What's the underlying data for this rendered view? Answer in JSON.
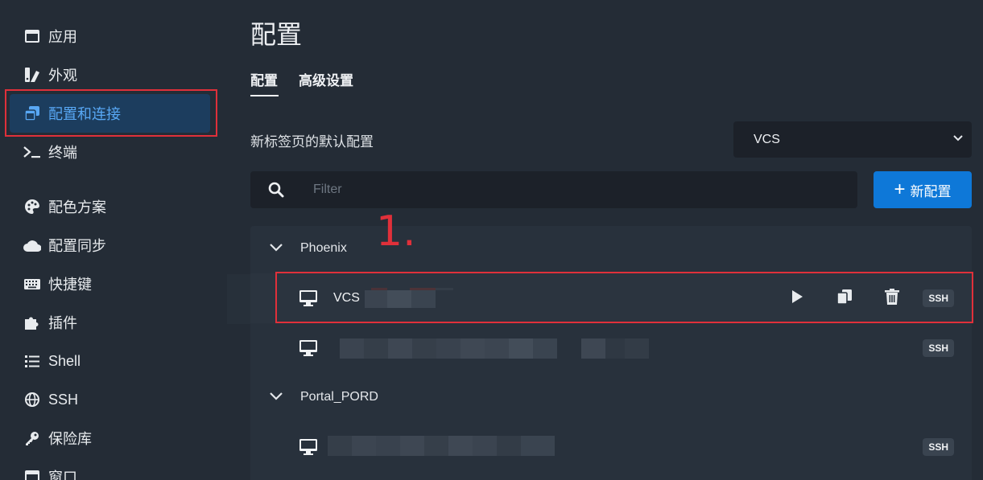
{
  "sidebar": {
    "items": [
      {
        "label": "应用",
        "icon": "app-window-icon"
      },
      {
        "label": "外观",
        "icon": "paint-brush-icon"
      },
      {
        "label": "配置和连接",
        "icon": "copy-windows-icon",
        "active": true
      },
      {
        "label": "终端",
        "icon": "terminal-prompt-icon"
      },
      {
        "label": "配色方案",
        "icon": "palette-icon"
      },
      {
        "label": "配置同步",
        "icon": "cloud-icon"
      },
      {
        "label": "快捷键",
        "icon": "keyboard-icon"
      },
      {
        "label": "插件",
        "icon": "puzzle-piece-icon"
      },
      {
        "label": "Shell",
        "icon": "list-icon"
      },
      {
        "label": "SSH",
        "icon": "globe-icon"
      },
      {
        "label": "保险库",
        "icon": "key-icon"
      },
      {
        "label": "窗口",
        "icon": "window-icon"
      }
    ]
  },
  "main": {
    "title": "配置",
    "tabs": [
      {
        "label": "配置",
        "active": true
      },
      {
        "label": "高级设置",
        "active": false
      }
    ],
    "default_profile_label": "新标签页的默认配置",
    "default_profile_value": "VCS",
    "filter_placeholder": "Filter",
    "new_profile_button": "新配置",
    "annotation": "1.",
    "groups": [
      {
        "name": "Phoenix",
        "profiles": [
          {
            "name": "VCS",
            "type": "SSH",
            "selected": true
          },
          {
            "name": "",
            "type": "SSH",
            "selected": false
          }
        ]
      },
      {
        "name": "Portal_PORD",
        "profiles": [
          {
            "name": "",
            "type": "SSH",
            "selected": false
          }
        ]
      }
    ]
  },
  "colors": {
    "accent": "#0e78d8",
    "active_nav_bg": "#1c3d5e",
    "active_nav_text": "#58a8f5",
    "annotation_red": "#e0303a",
    "background": "#242c36"
  }
}
